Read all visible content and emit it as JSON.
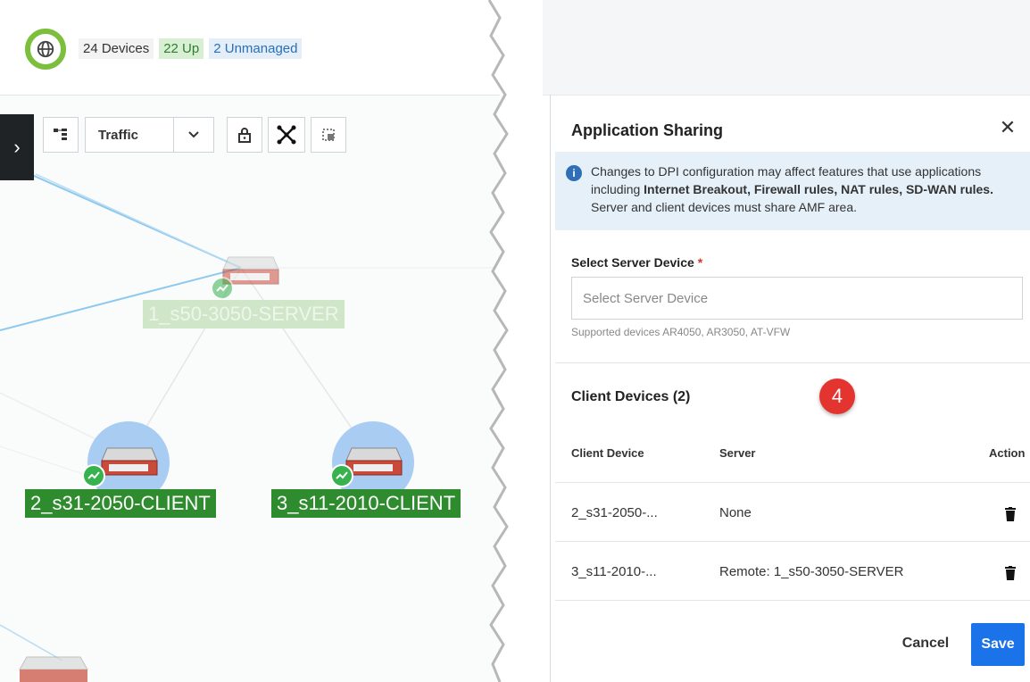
{
  "map": {
    "badges": {
      "devices": "24 Devices",
      "up": "22 Up",
      "unmanaged": "2 Unmanaged"
    },
    "toolbar": {
      "view_select": "Traffic"
    },
    "nodes": [
      {
        "label": "1_s50-3050-SERVER"
      },
      {
        "label": "2_s31-2050-CLIENT"
      },
      {
        "label": "3_s11-2010-CLIENT"
      }
    ]
  },
  "panel": {
    "title": "Application Sharing",
    "info": {
      "prefix": "Changes to DPI configuration may affect features that use applications including ",
      "bold": "Internet Breakout, Firewall rules, NAT rules, SD-WAN rules.",
      "suffix": " Server and client devices must share AMF area."
    },
    "server_field": {
      "label": "Select Server Device",
      "required_mark": "*",
      "placeholder": "Select Server Device",
      "hint": "Supported devices AR4050, AR3050, AT-VFW"
    },
    "clients": {
      "title": "Client Devices (2)",
      "step_marker": "4",
      "columns": [
        "Client Device",
        "Server",
        "Action"
      ],
      "rows": [
        {
          "device": "2_s31-2050-...",
          "server": "None"
        },
        {
          "device": "3_s11-2010-...",
          "server": "Remote: 1_s50-3050-SERVER"
        }
      ]
    },
    "buttons": {
      "cancel": "Cancel",
      "save": "Save"
    }
  }
}
